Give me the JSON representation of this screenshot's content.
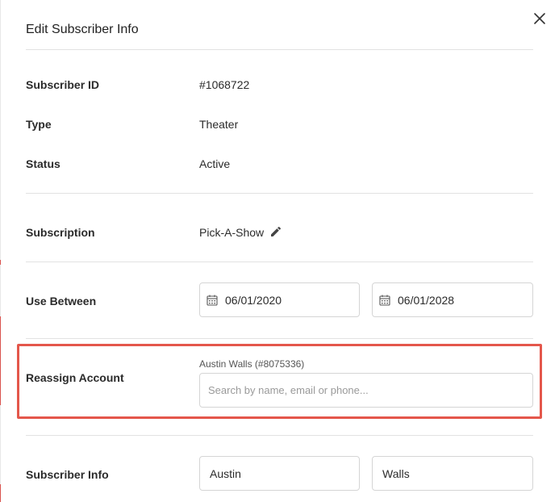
{
  "modal": {
    "title": "Edit Subscriber Info"
  },
  "fields": {
    "subscriber_id": {
      "label": "Subscriber ID",
      "value": "#1068722"
    },
    "type": {
      "label": "Type",
      "value": "Theater"
    },
    "status": {
      "label": "Status",
      "value": "Active"
    },
    "subscription": {
      "label": "Subscription",
      "value": "Pick-A-Show"
    },
    "use_between": {
      "label": "Use Between",
      "start": "06/01/2020",
      "end": "06/01/2028"
    },
    "reassign_account": {
      "label": "Reassign Account",
      "current_account": "Austin Walls (#8075336)",
      "placeholder": "Search by name, email or phone..."
    },
    "subscriber_info": {
      "label": "Subscriber Info",
      "first_name": "Austin",
      "last_name": "Walls"
    }
  },
  "icons": {
    "close": "close-icon",
    "edit": "pencil-icon",
    "date": "calendar-icon"
  },
  "colors": {
    "highlight": "#e4574b"
  }
}
